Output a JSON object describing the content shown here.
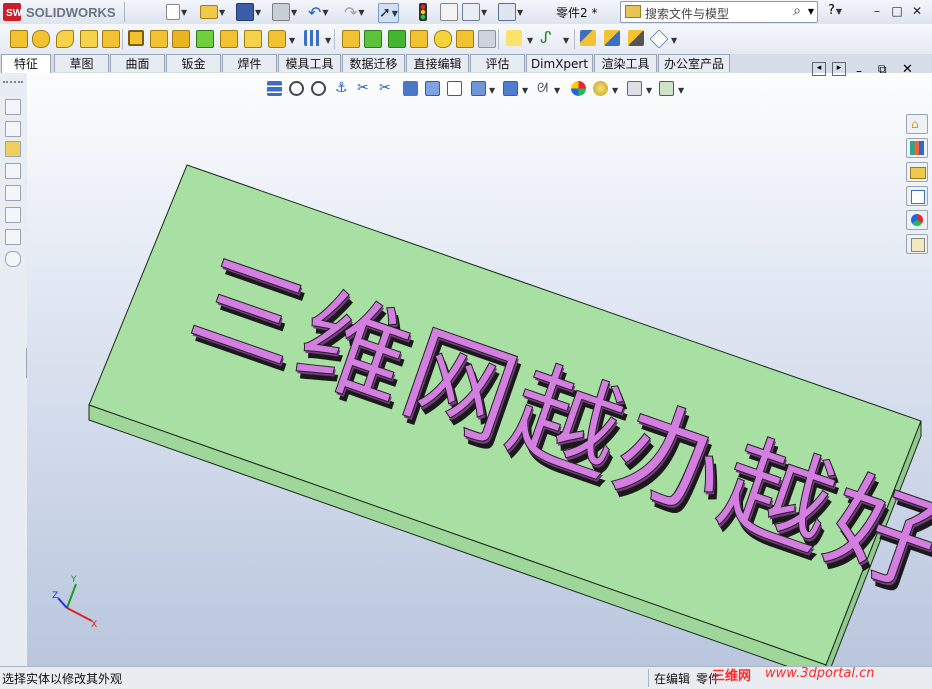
{
  "app": {
    "name": "SOLIDWORKS",
    "logo_text": "SOLIDWORKS"
  },
  "titlebar": {
    "document_title": "零件2 *",
    "search_placeholder": "搜索文件与模型",
    "help_label": "?",
    "window_buttons": {
      "minimize": "–",
      "restore": "□",
      "close": "✕"
    }
  },
  "tabs": [
    {
      "label": "特征",
      "active": true
    },
    {
      "label": "草图"
    },
    {
      "label": "曲面"
    },
    {
      "label": "钣金"
    },
    {
      "label": "焊件"
    },
    {
      "label": "模具工具"
    },
    {
      "label": "数据迁移"
    },
    {
      "label": "直接编辑"
    },
    {
      "label": "评估"
    },
    {
      "label": "DimXpert"
    },
    {
      "label": "渲染工具"
    },
    {
      "label": "办公室产品"
    }
  ],
  "model": {
    "text": "三维网越办越好",
    "plate_color": "#a8e0a3",
    "text_color": "#d37ee0"
  },
  "triad": {
    "x": "X",
    "y": "Y",
    "z": "Z"
  },
  "statusbar": {
    "message": "选择实体以修改其外观",
    "mode": "在编辑",
    "part": "零件",
    "watermark_cn": "三维网",
    "watermark_url": "www.3dportal.cn"
  },
  "colors": {
    "accent": "#1f5fbf",
    "viewport_top": "#fdfdfe",
    "viewport_bottom": "#b9c6dd"
  }
}
